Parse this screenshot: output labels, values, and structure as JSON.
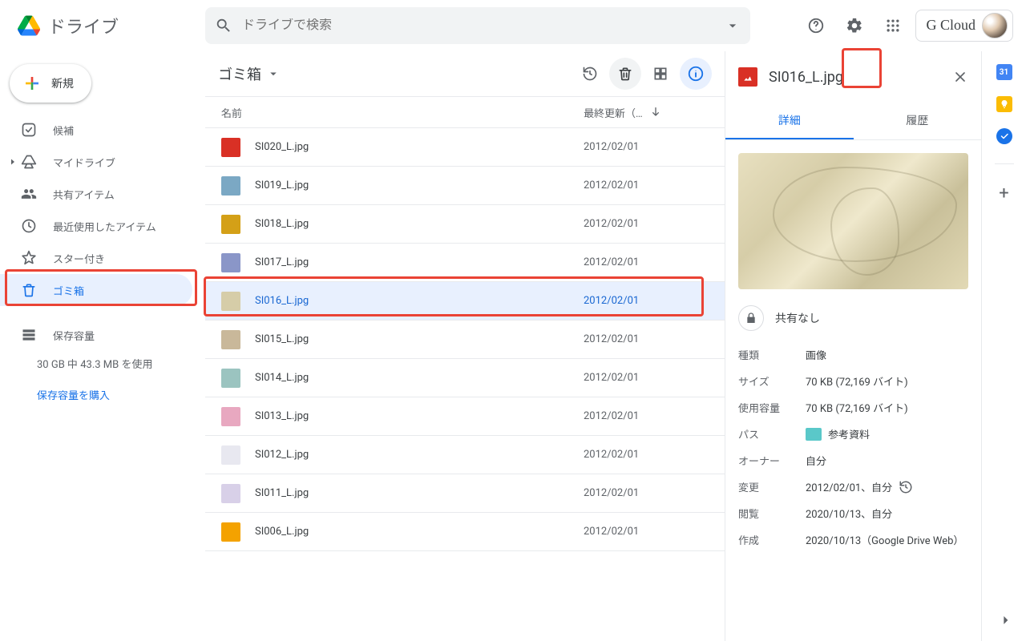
{
  "brand": {
    "title": "ドライブ"
  },
  "search": {
    "placeholder": "ドライブで検索"
  },
  "account": {
    "label": "G Cloud"
  },
  "sidebar": {
    "new_label": "新規",
    "items": [
      {
        "label": "候補"
      },
      {
        "label": "マイドライブ"
      },
      {
        "label": "共有アイテム"
      },
      {
        "label": "最近使用したアイテム"
      },
      {
        "label": "スター付き"
      },
      {
        "label": "ゴミ箱"
      }
    ],
    "storage_label": "保存容量",
    "storage_text": "30 GB 中 43.3 MB を使用",
    "buy_link": "保存容量を購入"
  },
  "toolbar": {
    "crumb": "ゴミ箱"
  },
  "columns": {
    "name": "名前",
    "date": "最終更新（…"
  },
  "files": [
    {
      "name": "SI020_L.jpg",
      "date": "2012/02/01",
      "color": "#d93025"
    },
    {
      "name": "SI019_L.jpg",
      "date": "2012/02/01",
      "color": "#7ba8c4"
    },
    {
      "name": "SI018_L.jpg",
      "date": "2012/02/01",
      "color": "#d4a017"
    },
    {
      "name": "SI017_L.jpg",
      "date": "2012/02/01",
      "color": "#8a96c8"
    },
    {
      "name": "SI016_L.jpg",
      "date": "2012/02/01",
      "color": "#d6cda8",
      "selected": true
    },
    {
      "name": "SI015_L.jpg",
      "date": "2012/02/01",
      "color": "#c9b89a"
    },
    {
      "name": "SI014_L.jpg",
      "date": "2012/02/01",
      "color": "#9bc4c0"
    },
    {
      "name": "SI013_L.jpg",
      "date": "2012/02/01",
      "color": "#e8a8c0"
    },
    {
      "name": "SI012_L.jpg",
      "date": "2012/02/01",
      "color": "#e8e8f0"
    },
    {
      "name": "SI011_L.jpg",
      "date": "2012/02/01",
      "color": "#d8d0e8"
    },
    {
      "name": "SI006_L.jpg",
      "date": "2012/02/01",
      "color": "#f4a200"
    }
  ],
  "details": {
    "title": "SI016_L.jpg",
    "tabs": {
      "detail": "詳細",
      "history": "履歴"
    },
    "share": "共有なし",
    "meta": {
      "type_k": "種類",
      "type_v": "画像",
      "size_k": "サイズ",
      "size_v": "70 KB (72,169 バイト)",
      "usage_k": "使用容量",
      "usage_v": "70 KB (72,169 バイト)",
      "path_k": "パス",
      "path_v": "参考資料",
      "owner_k": "オーナー",
      "owner_v": "自分",
      "mod_k": "変更",
      "mod_v": "2012/02/01、自分",
      "view_k": "閲覧",
      "view_v": "2020/10/13、自分",
      "create_k": "作成",
      "create_v": "2020/10/13（Google Drive Web）"
    }
  }
}
